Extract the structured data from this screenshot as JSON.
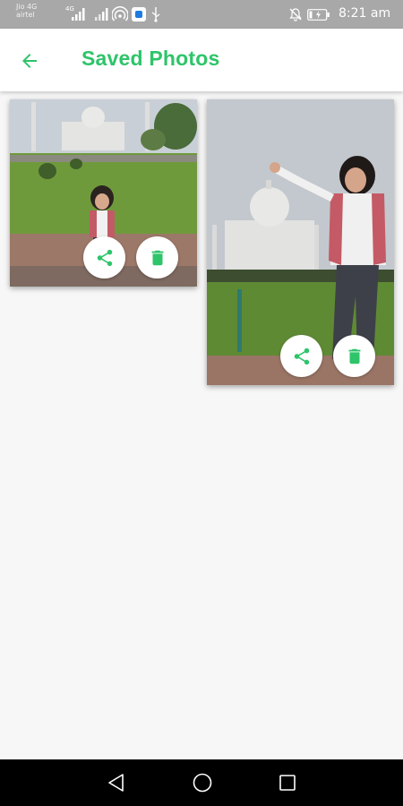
{
  "status_bar": {
    "carrier_line1": "Jio 4G",
    "carrier_line2": "airtel",
    "network_tag": "4G",
    "time": "8:21 am"
  },
  "app_bar": {
    "title": "Saved Photos",
    "back_icon": "arrow-back-icon"
  },
  "photos": [
    {
      "name": "saved-photo-1",
      "actions": [
        {
          "icon": "share-icon"
        },
        {
          "icon": "delete-icon"
        }
      ]
    },
    {
      "name": "saved-photo-2",
      "actions": [
        {
          "icon": "share-icon"
        },
        {
          "icon": "delete-icon"
        }
      ]
    }
  ],
  "nav_bar": {
    "icons": [
      "nav-back-icon",
      "nav-home-icon",
      "nav-recents-icon"
    ]
  },
  "colors": {
    "accent": "#2ec46a",
    "status_bar": "#a8a8a8",
    "background": "#f7f7f7",
    "nav_bar": "#000000"
  }
}
